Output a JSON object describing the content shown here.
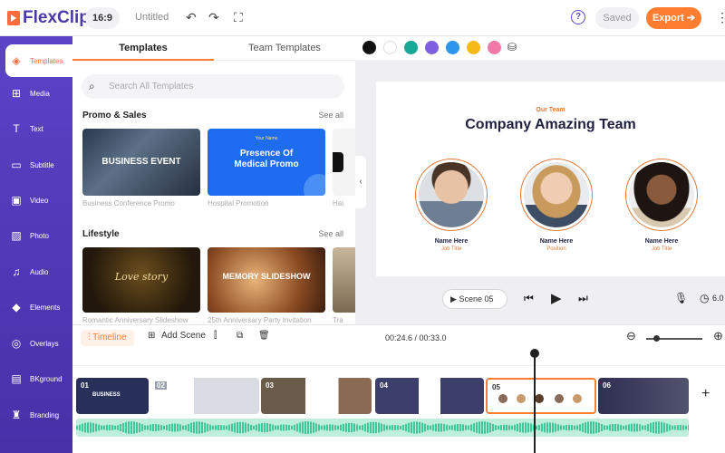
{
  "app": {
    "logo": "FlexClip"
  },
  "toolbar": {
    "ratio": "16:9",
    "title": "Untitled",
    "saved": "Saved",
    "export": "Export ➔"
  },
  "sidebar": {
    "items": [
      {
        "label": "Templates",
        "icon": "layers-icon"
      },
      {
        "label": "Media",
        "icon": "media-icon"
      },
      {
        "label": "Text",
        "icon": "text-icon"
      },
      {
        "label": "Subtitle",
        "icon": "subtitle-icon"
      },
      {
        "label": "Video",
        "icon": "video-icon"
      },
      {
        "label": "Photo",
        "icon": "photo-icon"
      },
      {
        "label": "Audio",
        "icon": "audio-icon"
      },
      {
        "label": "Elements",
        "icon": "elements-icon"
      },
      {
        "label": "Overlays",
        "icon": "overlays-icon"
      },
      {
        "label": "BKground",
        "icon": "background-icon"
      },
      {
        "label": "Branding",
        "icon": "branding-icon"
      }
    ]
  },
  "templates": {
    "tabs": [
      "Templates",
      "Team Templates"
    ],
    "search_placeholder": "Search All Templates",
    "sections": [
      {
        "title": "Promo & Sales",
        "see_all": "See all",
        "items": [
          {
            "caption": "Business Conference Promo",
            "thumb_text": "BUSINESS EVENT"
          },
          {
            "caption": "Hospital Promotion",
            "thumb_text": "Presence Of Medical Promo",
            "thumb_subtext": "Your Name"
          },
          {
            "caption": "Hai"
          }
        ]
      },
      {
        "title": "Lifestyle",
        "see_all": "See all",
        "items": [
          {
            "caption": "Romantic Anniversary Slideshow",
            "thumb_text": "Love story"
          },
          {
            "caption": "25th Anniversary Party Invitation",
            "thumb_text": "MEMORY SLIDESHOW"
          },
          {
            "caption": "Tra"
          }
        ]
      }
    ]
  },
  "colors": [
    "#111111",
    "#ffffff",
    "#1aa896",
    "#7d5fe0",
    "#2b95f0",
    "#f5b91a",
    "#f07aa8"
  ],
  "canvas": {
    "kicker": "Our Team",
    "headline": "Company Amazing Team",
    "members": [
      {
        "name": "Name Here",
        "role": "Job Title"
      },
      {
        "name": "Name Here",
        "role": "Position"
      },
      {
        "name": "Name Here",
        "role": "Job Title"
      }
    ]
  },
  "player": {
    "scene": "Scene 05",
    "duration": "6.0"
  },
  "timeline": {
    "tab": "Timeline",
    "add_scene": "Add Scene",
    "time": "00:24.6 / 00:33.0",
    "clips": [
      {
        "num": "01",
        "title": "BUSINESS"
      },
      {
        "num": "02"
      },
      {
        "num": "03"
      },
      {
        "num": "04"
      },
      {
        "num": "05"
      },
      {
        "num": "06"
      }
    ]
  }
}
